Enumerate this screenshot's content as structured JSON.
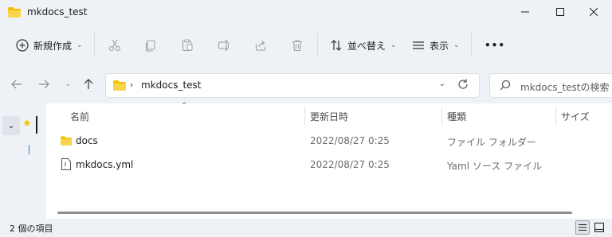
{
  "window": {
    "title": "mkdocs_test",
    "controls": [
      "minimize-icon",
      "maximize-icon",
      "close-icon"
    ]
  },
  "toolbar": {
    "new_label": "新規作成",
    "icons": [
      "cut-icon",
      "copy-icon",
      "paste-icon",
      "rename-icon",
      "share-icon",
      "delete-icon"
    ],
    "sort_label": "並べ替え",
    "view_label": "表示",
    "more_label": "•••"
  },
  "address": {
    "path": "mkdocs_test",
    "search_placeholder": "mkdocs_testの検索"
  },
  "columns": {
    "name": "名前",
    "date": "更新日時",
    "type": "種類",
    "size": "サイズ"
  },
  "files": [
    {
      "name": "docs",
      "date": "2022/08/27 0:25",
      "type": "ファイル フォルダー",
      "icon": "folder-icon"
    },
    {
      "name": "mkdocs.yml",
      "date": "2022/08/27 0:25",
      "type": "Yaml ソース ファイル",
      "icon": "file-icon"
    }
  ],
  "status": {
    "item_count": "2 個の項目"
  },
  "colors": {
    "folder": "#f2c200",
    "accent": "#2d7dd2",
    "background": "#eef2f7"
  }
}
